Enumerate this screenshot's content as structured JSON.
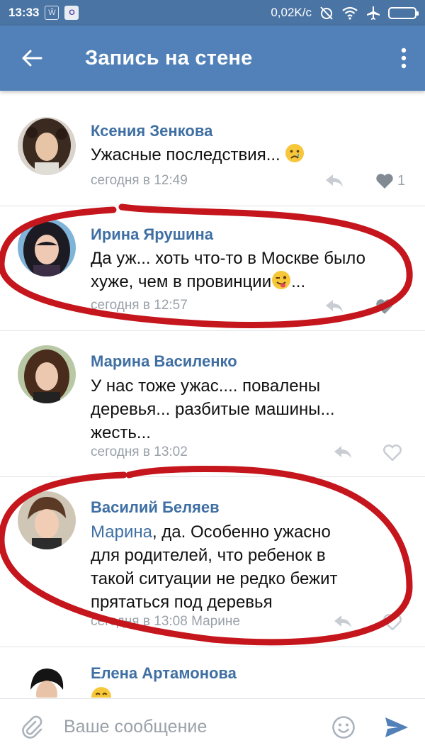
{
  "status_bar": {
    "time": "13:33",
    "app_icon_1": "Ŵ",
    "app_icon_2": "O",
    "network_speed": "0,02K/c",
    "icons": [
      "alarm-off-icon",
      "wifi-icon",
      "airplane-icon",
      "battery-icon"
    ]
  },
  "app_bar": {
    "title": "Запись на стене",
    "back_icon": "arrow-left-icon",
    "menu_icon": "more-vertical-icon",
    "background": "#5181b8"
  },
  "comments": [
    {
      "author": "Ксения Зенкова",
      "text": "Ужасные последствия...",
      "emoji": "crying-face",
      "time": "сегодня в 12:49",
      "likes": "1"
    },
    {
      "author": "Ирина Ярушина",
      "text_line1": "Да уж... хоть что-то в Москве было",
      "text_line2": "хуже, чем в провинции",
      "text_line2_after": "...",
      "emoji": "winking-tongue-face",
      "time": "сегодня в 12:57"
    },
    {
      "author": "Марина Василенко",
      "text_line1": "У нас тоже ужас.... повалены",
      "text_line2": "деревья... разбитые машины...",
      "text_line3": "жесть...",
      "time": "сегодня в 13:02"
    },
    {
      "author": "Василий Беляев",
      "mention": "Марина",
      "text_line1_rest": ", да. Особенно ужасно",
      "text_line2": "для родителей, что ребенок в",
      "text_line3": "такой ситуации не редко бежит",
      "text_line4": "прятаться под деревья",
      "time": "сегодня в 13:08 Марине"
    },
    {
      "author": "Елена Артамонова",
      "emoji": "smiling-face"
    }
  ],
  "composer": {
    "placeholder": "Ваше сообщение",
    "attach_icon": "paperclip-icon",
    "emoji_icon": "smiley-icon",
    "send_icon": "send-icon"
  },
  "colors": {
    "accent": "#5181b8",
    "name": "#3f6fa3",
    "meta": "#9aa1a9",
    "annotation": "#c4161c"
  }
}
